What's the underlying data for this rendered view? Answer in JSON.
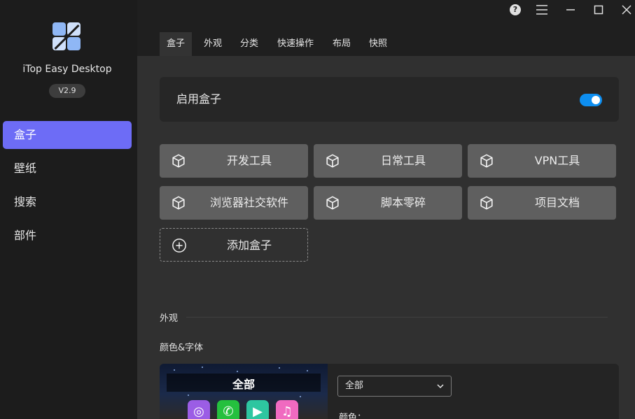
{
  "app": {
    "name": "iTop Easy Desktop",
    "version": "V2.9"
  },
  "sidebar": {
    "items": [
      {
        "label": "盒子",
        "active": true
      },
      {
        "label": "壁纸"
      },
      {
        "label": "搜索"
      },
      {
        "label": "部件"
      }
    ]
  },
  "titlebar": {
    "icons": [
      "help-icon",
      "menu-icon",
      "minimize-icon",
      "maximize-icon",
      "close-icon"
    ]
  },
  "tabs": [
    {
      "label": "盒子",
      "active": true
    },
    {
      "label": "外观"
    },
    {
      "label": "分类"
    },
    {
      "label": "快速操作"
    },
    {
      "label": "布局"
    },
    {
      "label": "快照"
    }
  ],
  "enable": {
    "label": "启用盒子",
    "on": true
  },
  "boxes": [
    {
      "label": "开发工具"
    },
    {
      "label": "日常工具"
    },
    {
      "label": "VPN工具"
    },
    {
      "label": "浏览器社交软件"
    },
    {
      "label": "脚本零碎"
    },
    {
      "label": "项目文档"
    }
  ],
  "add_box": {
    "label": "添加盒子"
  },
  "appearance": {
    "section_title": "外观",
    "color_font_label": "颜色&字体",
    "preview_title": "全部",
    "preview_apps": [
      "chrome-icon",
      "whatsapp-icon",
      "facetime-icon",
      "music-icon"
    ],
    "select_value": "全部",
    "color_label": "颜色："
  },
  "colors": {
    "accent": "#6d6cf6",
    "toggle": "#0d8ef0"
  }
}
